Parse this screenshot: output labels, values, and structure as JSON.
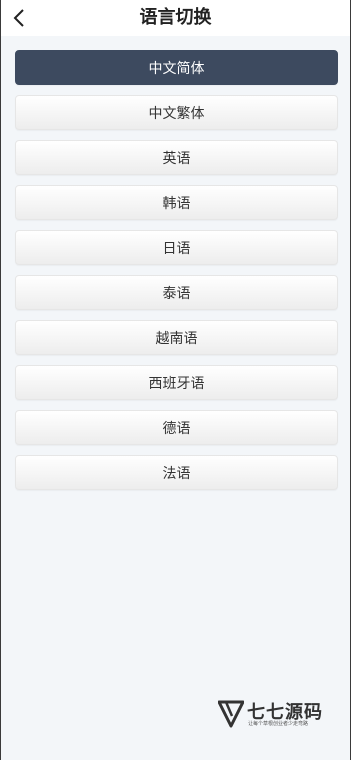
{
  "header": {
    "title": "语言切换",
    "back_icon": "chevron-left-icon"
  },
  "languages": [
    {
      "label": "中文简体",
      "selected": true
    },
    {
      "label": "中文繁体",
      "selected": false
    },
    {
      "label": "英语",
      "selected": false
    },
    {
      "label": "韩语",
      "selected": false
    },
    {
      "label": "日语",
      "selected": false
    },
    {
      "label": "泰语",
      "selected": false
    },
    {
      "label": "越南语",
      "selected": false
    },
    {
      "label": "西班牙语",
      "selected": false
    },
    {
      "label": "德语",
      "selected": false
    },
    {
      "label": "法语",
      "selected": false
    }
  ],
  "watermark": {
    "name": "七七源码",
    "slogan": "让每个草根创业者少走弯路"
  },
  "colors": {
    "active_bg": "#3d4a5f",
    "page_bg": "#f3f6f9"
  }
}
